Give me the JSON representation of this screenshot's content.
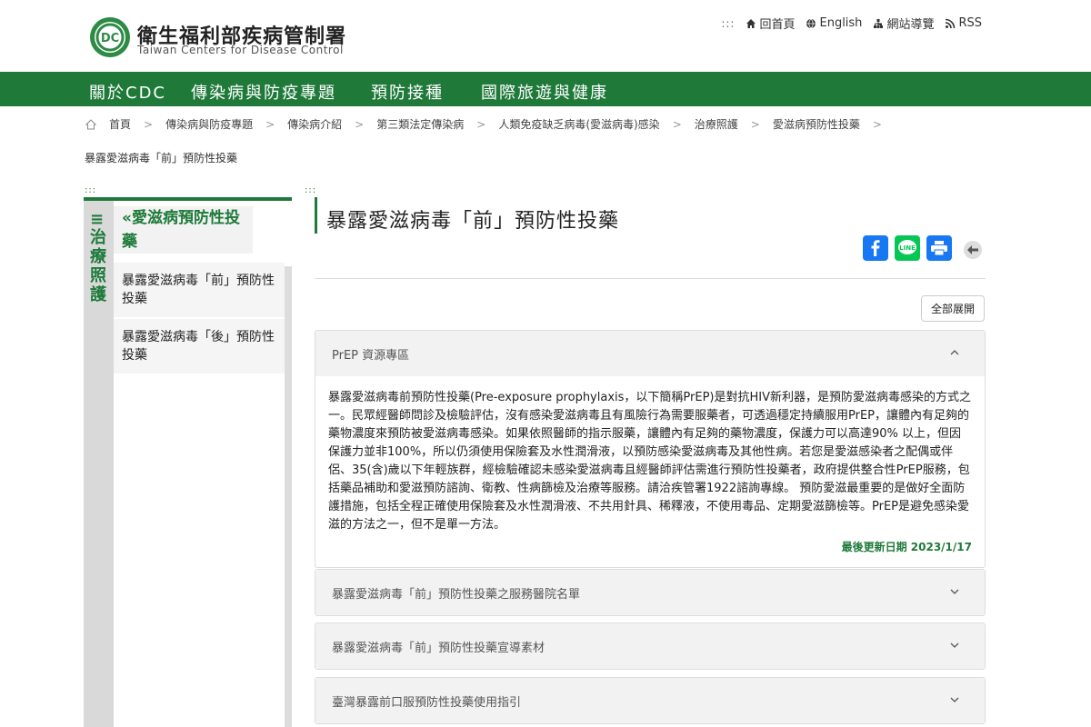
{
  "header": {
    "site_name": "衛生福利部疾病管制署",
    "site_name_en": "Taiwan Centers for Disease Control",
    "logo_icon": "cdc-logo",
    "util_dots": ":::",
    "util_links": [
      {
        "icon": "home-icon",
        "label": "回首頁"
      },
      {
        "icon": "globe-icon",
        "label": "English"
      },
      {
        "icon": "sitemap-icon",
        "label": "網站導覽"
      },
      {
        "icon": "rss-icon",
        "label": "RSS"
      }
    ]
  },
  "nav": {
    "items": [
      "關於CDC",
      "傳染病與防疫專題",
      "預防接種",
      "國際旅遊與健康"
    ]
  },
  "breadcrumb": {
    "items": [
      "首頁",
      "傳染病與防疫專題",
      "傳染病介紹",
      "第三類法定傳染病",
      "人類免疫缺乏病毒(愛滋病毒)感染",
      "治療照護",
      "愛滋病預防性投藥"
    ],
    "sep": ">",
    "current": "暴露愛滋病毒「前」預防性投藥"
  },
  "section_dots": ":::",
  "sidebar": {
    "menu_icon": "≡",
    "vertical_label": "治療照護",
    "title": "«愛滋病預防性投藥",
    "links": [
      "暴露愛滋病毒「前」預防性投藥",
      "暴露愛滋病毒「後」預防性投藥"
    ]
  },
  "main": {
    "title": "暴露愛滋病毒「前」預防性投藥",
    "share_icons": [
      "facebook-icon",
      "line-icon",
      "print-icon",
      "back-icon"
    ],
    "expand_all": "全部展開",
    "accordions": [
      {
        "title": "PrEP 資源專區",
        "open": true,
        "body": "暴露愛滋病毒前預防性投藥(Pre-exposure prophylaxis，以下簡稱PrEP)是對抗HIV新利器，是預防愛滋病毒感染的方式之一。民眾經醫師問診及檢驗評估，沒有感染愛滋病毒且有風險行為需要服藥者，可透過穩定持續服用PrEP，讓體內有足夠的藥物濃度來預防被愛滋病毒感染。如果依照醫師的指示服藥，讓體內有足夠的藥物濃度，保護力可以高達90% 以上，但因保護力並非100%，所以仍須使用保險套及水性潤滑液，以預防感染愛滋病毒及其他性病。若您是愛滋感染者之配偶或伴侶、35(含)歲以下年輕族群，經檢驗確認未感染愛滋病毒且經醫師評估需進行預防性投藥者，政府提供整合性PrEP服務，包括藥品補助和愛滋預防諮詢、衛教、性病篩檢及治療等服務。請洽疾管署1922諮詢專線。 預防愛滋最重要的是做好全面防護措施，包括全程正確使用保險套及水性潤滑液、不共用針具、稀釋液，不使用毒品、定期愛滋篩檢等。PrEP是避免感染愛滋的方法之一，但不是單一方法。",
        "updated": "最後更新日期 2023/1/17"
      },
      {
        "title": "暴露愛滋病毒「前」預防性投藥之服務醫院名單",
        "open": false
      },
      {
        "title": "暴露愛滋病毒「前」預防性投藥宣導素材",
        "open": false
      },
      {
        "title": "臺灣暴露前口服預防性投藥使用指引",
        "open": false
      }
    ]
  },
  "colors": {
    "brand_green": "#1f7a3a",
    "facebook": "#1877f2",
    "line": "#06c755",
    "print": "#1877f2"
  }
}
